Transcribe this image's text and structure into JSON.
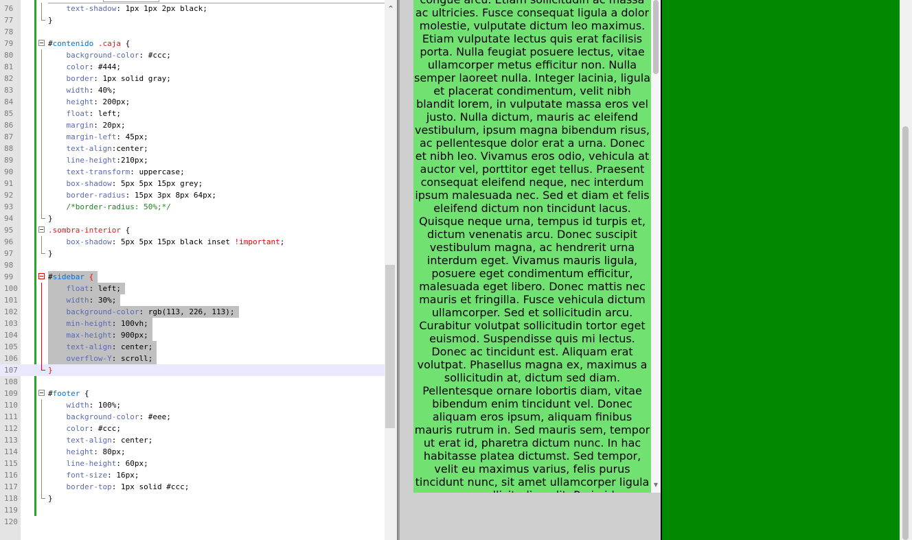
{
  "editor": {
    "lines": [
      {
        "n": "76",
        "html": "    <span class='t-prop'>text-shadow</span>: 1px 1px 2px black;"
      },
      {
        "n": "77",
        "html": "}"
      },
      {
        "n": "78",
        "html": ""
      },
      {
        "n": "79",
        "html": "<span class='t-hash'>#</span><span class='t-sel'>contenido</span> <span class='t-cls'>.caja</span> {"
      },
      {
        "n": "80",
        "html": "    <span class='t-prop'>background-color</span>: #ccc;"
      },
      {
        "n": "81",
        "html": "    <span class='t-prop'>color</span>: #444;"
      },
      {
        "n": "82",
        "html": "    <span class='t-prop'>border</span>: 1px solid gray;"
      },
      {
        "n": "83",
        "html": "    <span class='t-prop'>width</span>: 40%;"
      },
      {
        "n": "84",
        "html": "    <span class='t-prop'>height</span>: 200px;"
      },
      {
        "n": "85",
        "html": "    <span class='t-prop'>float</span>: left;"
      },
      {
        "n": "86",
        "html": "    <span class='t-prop'>margin</span>: 20px;"
      },
      {
        "n": "87",
        "html": "    <span class='t-prop'>margin-left</span>: 45px;"
      },
      {
        "n": "88",
        "html": "    <span class='t-prop'>text-align</span>:center;"
      },
      {
        "n": "89",
        "html": "    <span class='t-prop'>line-height</span>:210px;"
      },
      {
        "n": "90",
        "html": "    <span class='t-prop'>text-transform</span>: uppercase;"
      },
      {
        "n": "91",
        "html": "    <span class='t-prop'>box-shadow</span>: 5px 5px 15px grey;"
      },
      {
        "n": "92",
        "html": "    <span class='t-prop'>border-radius</span>: 15px 3px 8px 64px;"
      },
      {
        "n": "93",
        "html": "    <span class='t-cmt'>/*border-radius: 50%;*/</span>"
      },
      {
        "n": "94",
        "html": "}"
      },
      {
        "n": "95",
        "html": "<span class='t-cls'>.sombra-interior</span> {"
      },
      {
        "n": "96",
        "html": "    <span class='t-prop'>box-shadow</span>: 5px 5px 15px black inset <span class='t-imp'>!important</span>;"
      },
      {
        "n": "97",
        "html": "}"
      },
      {
        "n": "98",
        "html": ""
      },
      {
        "n": "99",
        "html": "<span class='t-hash'>#</span><span class='t-sel'>sidebar</span> <span class='t-redbrace'>{</span>"
      },
      {
        "n": "100",
        "html": "    <span class='t-prop'>float</span>: left;"
      },
      {
        "n": "101",
        "html": "    <span class='t-prop'>width</span>: 30%;"
      },
      {
        "n": "102",
        "html": "    <span class='t-prop'>background-color</span>: rgb(113, 226, 113);"
      },
      {
        "n": "103",
        "html": "    <span class='t-prop'>min-height</span>: 100vh;"
      },
      {
        "n": "104",
        "html": "    <span class='t-prop'>max-height</span>: 900px;"
      },
      {
        "n": "105",
        "html": "    <span class='t-prop'>text-align</span>: center;"
      },
      {
        "n": "106",
        "html": "    <span class='t-prop'>overflow-Y</span>: scroll;"
      },
      {
        "n": "107",
        "html": "<span class='t-redbrace'>}</span>"
      },
      {
        "n": "108",
        "html": ""
      },
      {
        "n": "109",
        "html": "<span class='t-hash'>#</span><span class='t-sel'>footer</span> {"
      },
      {
        "n": "110",
        "html": "    <span class='t-prop'>width</span>: 100%;"
      },
      {
        "n": "111",
        "html": "    <span class='t-prop'>background-color</span>: #eee;"
      },
      {
        "n": "112",
        "html": "    <span class='t-prop'>color</span>: #ccc;"
      },
      {
        "n": "113",
        "html": "    <span class='t-prop'>text-align</span>: center;"
      },
      {
        "n": "114",
        "html": "    <span class='t-prop'>height</span>: 80px;"
      },
      {
        "n": "115",
        "html": "    <span class='t-prop'>line-height</span>: 60px;"
      },
      {
        "n": "116",
        "html": "    <span class='t-prop'>font-size</span>: 16px;"
      },
      {
        "n": "117",
        "html": "    <span class='t-prop'>border-top</span>: 1px solid #ccc;"
      },
      {
        "n": "118",
        "html": "}"
      },
      {
        "n": "119",
        "html": ""
      },
      {
        "n": "120",
        "html": ""
      }
    ]
  },
  "preview": {
    "sidebar_text": "congue arcu. Etiam sollicitudin ac massa ac ultricies. Fusce consequat ligula a dolor molestie, vulputate dictum leo maximus. Etiam vulputate lectus quis erat facilisis porta. Nulla feugiat posuere lectus, vitae ullamcorper metus efficitur non. Nulla semper laoreet nulla. Integer lacinia, ligula et placerat condimentum, velit nibh blandit lorem, in vulputate massa eros vel justo. Nulla dictum, mauris ac eleifend vestibulum, ipsum magna bibendum risus, ac pellentesque dolor erat a urna. Donec et nibh leo. Vivamus eros odio, vehicula at auctor vel, porttitor eget tellus. Praesent consequat eleifend neque, nec interdum ipsum malesuada nec. Sed et diam et felis eleifend dictum non tincidunt lacus. Quisque neque urna, tempus id turpis et, dictum venenatis arcu. Donec suscipit vestibulum magna, ac hendrerit urna interdum eget. Vivamus mauris ligula, posuere eget condimentum efficitur, malesuada eget libero. Donec mattis nec mauris et fringilla. Fusce vehicula dictum ullamcorper. Sed et sollicitudin arcu. Curabitur volutpat sollicitudin tortor eget euismod. Suspendisse quis mi lectus. Donec ac tincidunt est. Aliquam erat volutpat. Phasellus magna ex, maximus a sollicitudin at, dictum sed diam. Pellentesque ornare lobortis diam, vitae bibendum enim tincidunt vel. Donec aliquam eros ipsum, aliquam finibus mauris rutrum in. Sed mauris sem, tempor ut erat id, pharetra dictum nunc. In hac habitasse platea dictumst. Sed tempor, velit eu maximus varius, felis purus tincidunt nunc, sit amet ullamcorper ligula nunc sollicitudin velit. Proin id",
    "sidebar_color": "#71e271",
    "content_color": "#008800"
  },
  "colors": {
    "change_bar": "#2aa52a",
    "selection": "#c0c0c0",
    "current_line": "#e8e8ff"
  }
}
